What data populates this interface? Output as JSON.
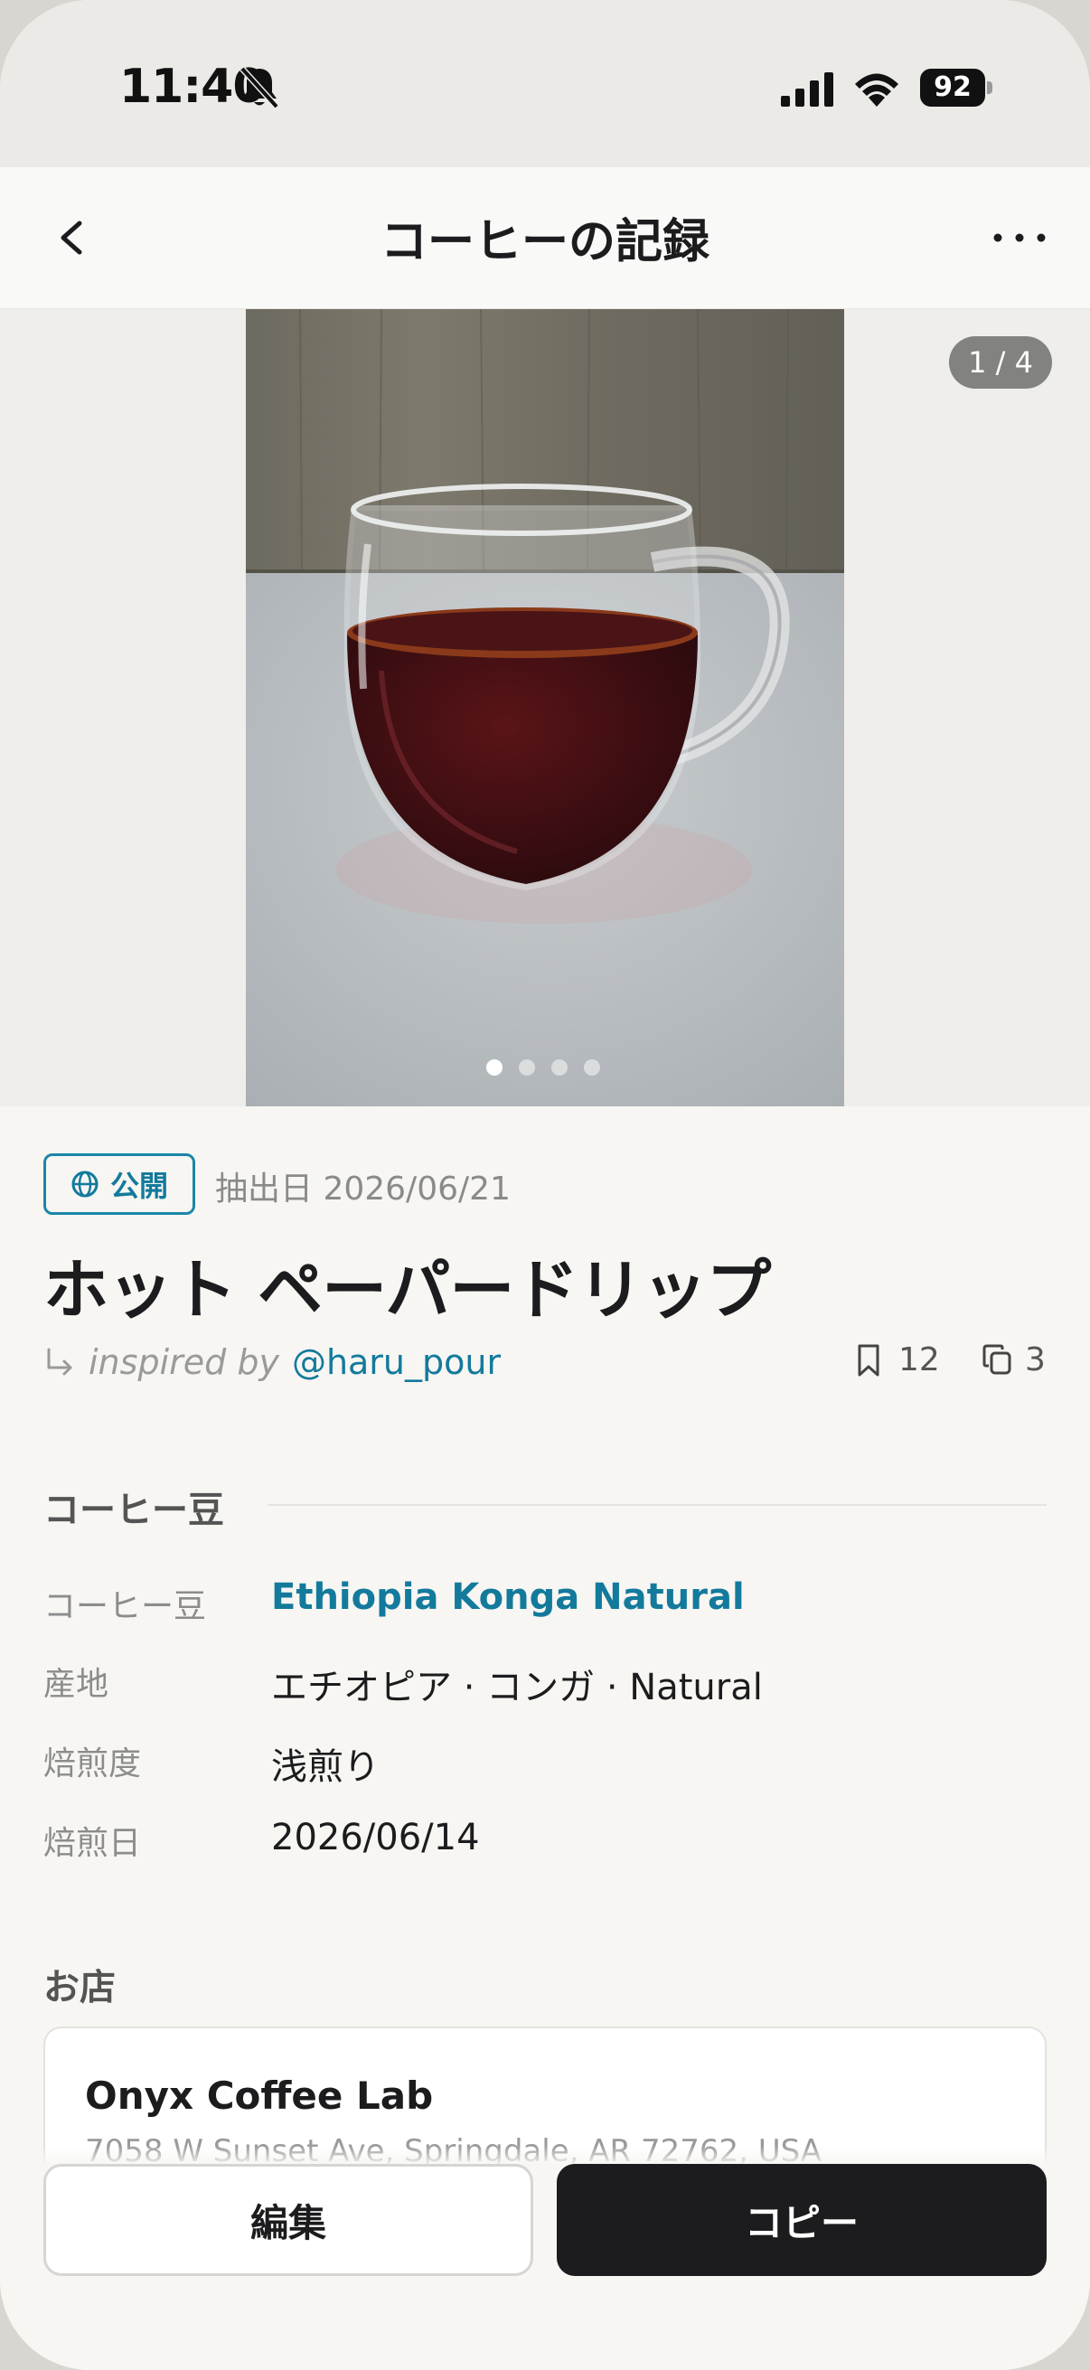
{
  "status_bar": {
    "time": "11:40",
    "battery": "92",
    "icons": [
      "bell-slash-icon",
      "cellular-signal-icon",
      "wifi-icon",
      "battery-icon"
    ]
  },
  "nav": {
    "title": "コーヒーの記録",
    "back_icon": "chevron-left-icon",
    "more_icon": "ellipsis-icon"
  },
  "photo": {
    "counter": "1 / 4",
    "total": 4,
    "current": 1
  },
  "meta": {
    "visibility": "公開",
    "visibility_icon": "globe-icon",
    "brew_date": "抽出日 2026/06/21",
    "title": "ホット ペーパードリップ",
    "inspired_prefix": "inspired by",
    "inspired_user": "@haru_pour",
    "bookmark_count": "12",
    "copy_count": "3"
  },
  "beans_section": {
    "title": "コーヒー豆",
    "fields": [
      {
        "label": "コーヒー豆",
        "value": "Ethiopia Konga Natural"
      },
      {
        "label": "産地",
        "value": "エチオピア · コンガ · Natural"
      },
      {
        "label": "焙煎度",
        "value": "浅煎り"
      },
      {
        "label": "焙煎日",
        "value": "2026/06/14"
      }
    ]
  },
  "shop_section": {
    "title": "お店",
    "name": "Onyx Coffee Lab",
    "address": "7058 W Sunset Ave, Springdale, AR 72762, USA"
  },
  "actions": {
    "edit": "編集",
    "copy": "コピー"
  },
  "colors": {
    "accent": "#137a9c",
    "primary_button": "#1c1c1e",
    "background": "#f7f6f3"
  }
}
